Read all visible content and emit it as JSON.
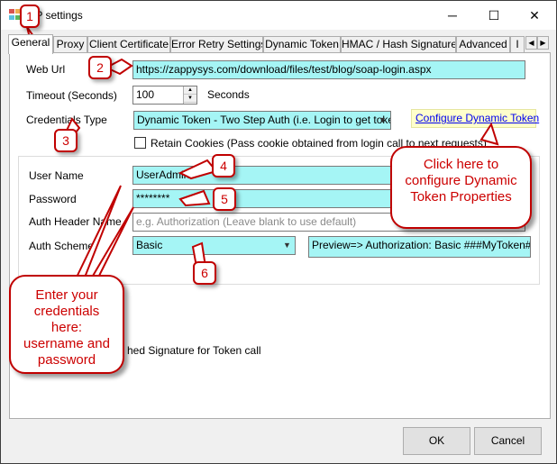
{
  "window": {
    "title": "TP settings",
    "minimize_glyph": "─",
    "maximize_glyph": "☐",
    "close_glyph": "✕"
  },
  "tabs": [
    {
      "label": "General"
    },
    {
      "label": "Proxy"
    },
    {
      "label": "Client Certificate"
    },
    {
      "label": "Error Retry Settings"
    },
    {
      "label": "Dynamic Token"
    },
    {
      "label": "HMAC / Hash Signature"
    },
    {
      "label": "Advanced"
    },
    {
      "label": "I"
    }
  ],
  "tab_scroll": {
    "left": "◀",
    "right": "▶"
  },
  "form": {
    "web_url_label": "Web Url",
    "web_url_value": "https://zappysys.com/download/files/test/blog/soap-login.aspx",
    "timeout_label": "Timeout (Seconds)",
    "timeout_value": "100",
    "timeout_unit": "Seconds",
    "credentials_type_label": "Credentials Type",
    "credentials_type_value": "Dynamic Token - Two Step Auth (i.e. Login to get toker",
    "configure_link": "Configure Dynamic Token",
    "retain_cookies_label": "Retain Cookies (Pass cookie obtained from login call to next requests)",
    "user_name_label": "User Name",
    "user_name_value": "UserAdmin",
    "password_label": "Password",
    "password_value": "********",
    "auth_header_label": "Auth Header Name",
    "auth_header_placeholder": "e.g. Authorization    (Leave blank to use default)",
    "auth_scheme_label": "Auth Scheme",
    "auth_scheme_value": "Basic",
    "preview_text": "Preview=> Authorization: Basic ###MyToken###",
    "signature_partial_text": "hed Signature for Token call"
  },
  "buttons": {
    "ok": "OK",
    "cancel": "Cancel"
  },
  "annotations": {
    "num1": "1",
    "num2": "2",
    "num3": "3",
    "num4": "4",
    "num5": "5",
    "num6": "6",
    "configure_callout": "Click here to configure Dynamic Token Properties",
    "credentials_callout": "Enter your credentials here: username and password"
  },
  "colors": {
    "annotation_red": "#c00000",
    "highlight_cyan": "#a5f5f5",
    "link_blue": "#0000ee"
  }
}
